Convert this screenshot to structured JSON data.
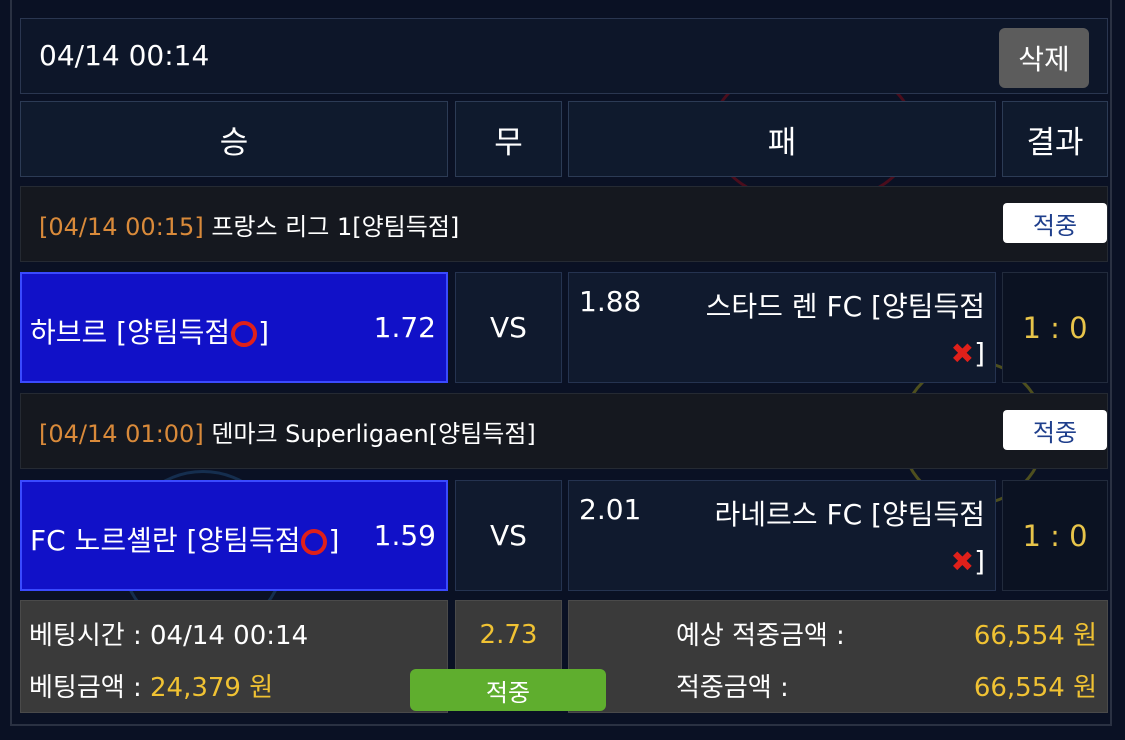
{
  "header": {
    "datetime": "04/14 00:14",
    "delete_label": "삭제"
  },
  "columns": {
    "win": "승",
    "draw": "무",
    "lose": "패",
    "result": "결과"
  },
  "matches": [
    {
      "time": "[04/14 00:15]",
      "league": " 프랑스 리그 1[양팀득점]",
      "status": "적중",
      "home_name": "하브르 [양팀득점",
      "home_close": "]",
      "home_odds": "1.72",
      "vs": "VS",
      "away_odds": "1.88",
      "away_name": "스타드 렌 FC [양팀득점",
      "away_close": "]",
      "result": "1 : 0"
    },
    {
      "time": "[04/14 01:00]",
      "league": " 덴마크 Superligaen[양팀득점]",
      "status": "적중",
      "home_name": "FC 노르셸란 [양팀득점",
      "home_close": "]",
      "home_odds": "1.59",
      "vs": "VS",
      "away_odds": "2.01",
      "away_name": "라네르스 FC [양팀득점",
      "away_close": "]",
      "result": "1 : 0"
    }
  ],
  "summary": {
    "bet_time_label": "베팅시간 : ",
    "bet_time": "04/14 00:14",
    "bet_amount_label": "베팅금액 : ",
    "bet_amount": "24,379 원",
    "total_odds": "2.73",
    "status_button": "적중",
    "expected_label": "예상 적중금액 :",
    "expected_value": "66,554 원",
    "hit_label": "적중금액 :",
    "hit_value": "66,554 원"
  },
  "icons": {
    "hit_mark": "red-circle",
    "miss_mark": "red-x"
  },
  "colors": {
    "home_bg": "#1111c8",
    "accent_time": "#d98a3a",
    "result_gold": "#e8c44a",
    "value_gold": "#f0c233",
    "status_green": "#5fae2e"
  }
}
